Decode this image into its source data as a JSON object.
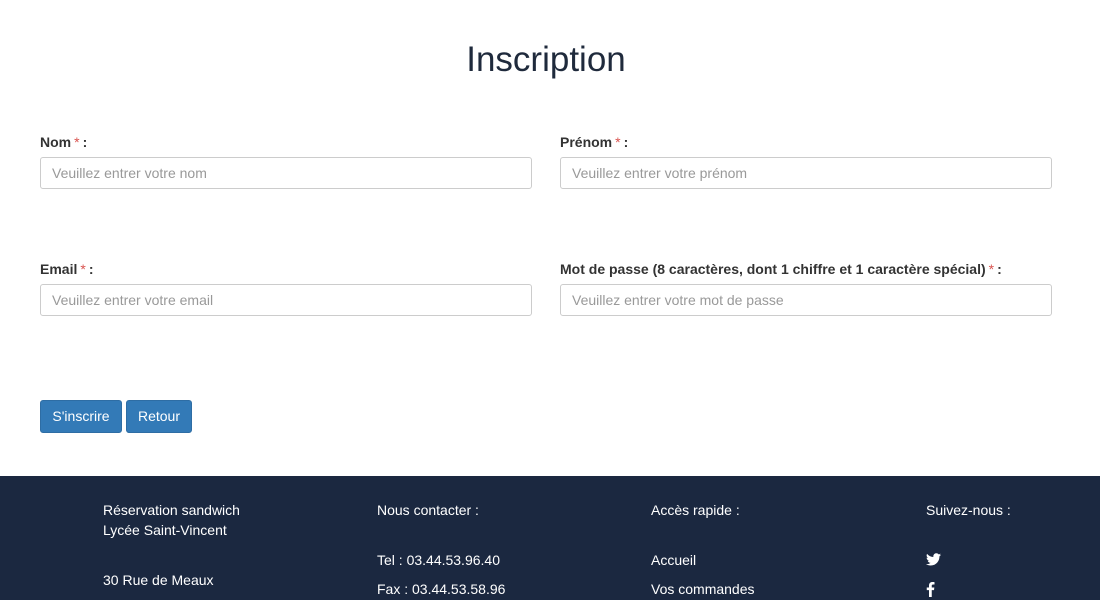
{
  "page": {
    "title": "Inscription"
  },
  "form": {
    "required_marker": "*",
    "colon": ":",
    "nom": {
      "label": "Nom",
      "placeholder": "Veuillez entrer votre nom",
      "value": ""
    },
    "prenom": {
      "label": "Prénom",
      "placeholder": "Veuillez entrer votre prénom",
      "value": ""
    },
    "email": {
      "label": "Email",
      "placeholder": "Veuillez entrer votre email",
      "value": ""
    },
    "password": {
      "label": "Mot de passe (8 caractères, dont 1 chiffre et 1 caractère spécial)",
      "placeholder": "Veuillez entrer votre mot de passe",
      "value": ""
    },
    "submit_label": "S'inscrire",
    "back_label": "Retour"
  },
  "footer": {
    "about": {
      "line1": "Réservation sandwich",
      "line2": "Lycée Saint-Vincent",
      "address": "30 Rue de Meaux"
    },
    "contact": {
      "heading": "Nous contacter :",
      "tel": "Tel : 03.44.53.96.40",
      "fax": "Fax : 03.44.53.58.96"
    },
    "quick_access": {
      "heading": "Accès rapide :",
      "items": [
        "Accueil",
        "Vos commandes"
      ]
    },
    "social": {
      "heading": "Suivez-nous :",
      "icons": [
        "twitter-icon",
        "facebook-icon"
      ]
    }
  },
  "colors": {
    "primary": "#337ab7",
    "footer_bg": "#1b2840",
    "required": "#d9534f"
  }
}
